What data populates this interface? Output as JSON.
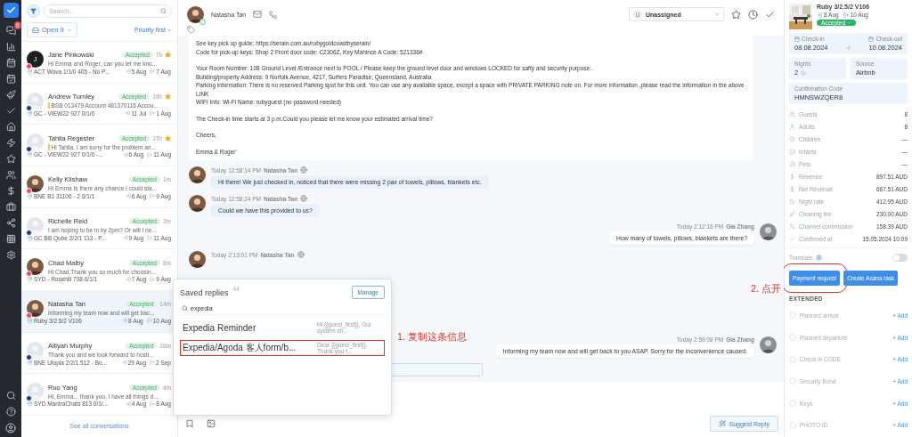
{
  "nav_badge": "8",
  "list": {
    "search_placeholder": "Search...",
    "filter_label": "Open",
    "filter_count": "9",
    "sort": "Priority first",
    "see_all": "See all conversations"
  },
  "conversations": [
    {
      "name": "Jane Pinkowski",
      "status": "Accepted",
      "time": "7h",
      "starred": true,
      "note": false,
      "preview": "Hi Emma and Roger, can you let me kno...",
      "location": "ACT Wova 1/1/0 405 - No P...",
      "check_in": "5 Aug",
      "check_out": "7 Aug",
      "kind": "initial",
      "initial": "J",
      "color": "#e5505b",
      "selected": false
    },
    {
      "name": "Andrew Turnley",
      "status": "Accepted",
      "time": "19h",
      "starred": true,
      "note": true,
      "preview": "BSB 013479 Account 481370116 Accou...",
      "location": "GC - VIEW22 927 0/1/0",
      "check_in": "11 Jul",
      "check_out": "1 Aug",
      "kind": "placeholder",
      "color": "#233a82",
      "selected": false
    },
    {
      "name": "Tahlia Regester",
      "status": "Accepted",
      "time": "17h",
      "starred": true,
      "note": true,
      "preview": "Hi Tahlia, I am sorry for the problem an...",
      "location": "GC - VIEW22 927 0/1/0 -...",
      "check_in": "6 Aug",
      "check_out": "11 Aug",
      "kind": "placeholder",
      "color": "#233a82",
      "selected": false
    },
    {
      "name": "Kelly Kilshaw",
      "status": "Accepted",
      "time": "1m",
      "starred": false,
      "note": false,
      "preview": "Hi Emma Is there any chance I could sta...",
      "location": "BNE B1 31106 - 2 0/1/1",
      "check_in": "6 Aug",
      "check_out": "9 Aug",
      "color": "#e5505b",
      "selected": false
    },
    {
      "name": "Richelle Reid",
      "status": "Accepted",
      "time": "3m",
      "starred": false,
      "note": false,
      "preview": "I am hoping to be in by 2pm? Or will I ne...",
      "location": "GC BB Qube 2/2/1 113 - P...",
      "check_in": "9 Aug",
      "check_out": "11 Aug",
      "kind": "placeholder",
      "color": "#233a82",
      "selected": false
    },
    {
      "name": "Chad Malby",
      "status": "Accepted",
      "time": "8m",
      "starred": false,
      "note": false,
      "preview": "Hi Chad,Thank you so much for choosin...",
      "location": "SYD - Rosehill 708 0/1/1",
      "check_in": "7 Aug",
      "check_out": "9 Aug",
      "color": "#e5505b",
      "selected": false
    },
    {
      "name": "Natasha Tan",
      "status": "Accepted",
      "time": "14m",
      "starred": false,
      "note": false,
      "preview": "Informing my team now and will get bac...",
      "location": "Ruby 3/2.5/2 V106",
      "check_in": "8 Aug",
      "check_out": "10 Aug",
      "color": "#e5505b",
      "selected": true
    },
    {
      "name": "Alliyah Murphy",
      "status": "Accepted",
      "time": "16m",
      "starred": false,
      "note": false,
      "preview": "Thank you and we look forward to hosti...",
      "location": "BNE Utopia 2/2/1 512 - Bo...",
      "check_in": "29 Aug",
      "check_out": "2 Sep",
      "kind": "placeholder",
      "color": "#233a82",
      "selected": false
    },
    {
      "name": "Ruo Yang",
      "status": "Accepted",
      "time": "4m",
      "starred": false,
      "note": false,
      "preview": "Hi, Emma... thank you, I have all things d...",
      "location": "SYD MantraChats 813 0/1/...",
      "check_in": "4 Aug",
      "check_out": "8 Aug",
      "kind": "placeholder",
      "color": "#233a82",
      "selected": false
    }
  ],
  "header": {
    "contact": "Natasha Tan",
    "assignee_initial": "U",
    "assignee": "Unassigned"
  },
  "card_paragraphs": [
    [
      "See key pick up guide: https://serain.com.au/rubygoldcoastbyserain/",
      "Code for pick-up keys: Shop 2 Front door code: C2306Z, Key Mahince A Code: 521336#"
    ],
    [
      "Your Room Number: 108 Ground Level /Entrance next to POOL / Please keep the ground level door and windows LOCKED for safty and security purpose..",
      "Building/property Address: 9 Norfolk Avenue, 4217, Surfers Paradise, Queensland, Australia",
      "Parking information: There is no reserved Parking spot for this unit. You can use any available space, except a space with PRIVATE PARKING note on. For more information ,please read the information in the above LINK",
      "WIFI Info: Wi-Fi Name: rubyguest (no password needed)"
    ],
    [
      "The Check-in time starts at 3 p.m.Could you please let me know your estimated arrival time?"
    ],
    [
      "Cheers,"
    ],
    [
      "Emma & Roger'"
    ]
  ],
  "messages": [
    {
      "kind": "in",
      "time": "Today 12:58:14 PM",
      "author": "Natasha Tan",
      "text": "Hi there! We just checked in, noticed that there were missing 2 pax of towels, pillows, blankets etc."
    },
    {
      "kind": "in",
      "time": "Today 12:58:24 PM",
      "author": "Natasha Tan",
      "text": "Could we have this provided to us?"
    },
    {
      "kind": "out",
      "time": "Today 2:12:16 PM",
      "author": "Gia Zhang",
      "text": "How many of towels, pillows, blankets are there?"
    },
    {
      "kind": "in",
      "time": "Today 2:13:01 PM",
      "author": "Natasha Tan"
    },
    {
      "kind": "out",
      "time": "Today 2:59:08 PM",
      "author": "Gia Zhang",
      "text": "Informing my team now and will get back to you ASAP. Sorry for the inconvenience caused."
    }
  ],
  "saved_replies": {
    "title": "Saved replies",
    "count": "44",
    "manage": "Manage",
    "search": "expedia",
    "items": [
      {
        "title": "Expedia Reminder",
        "snippet": "Hi {{guest_first}}, Our system sh...",
        "boxed": false
      },
      {
        "title": "Expedia/Agoda 客人form/b...",
        "snippet": "Dear {{guest_first}}, Thank you f...",
        "boxed": true
      }
    ]
  },
  "composer": {
    "suggest": "Suggest Reply"
  },
  "annotations": [
    {
      "text": "1. 复制这条信息",
      "kind": "step1"
    },
    {
      "text": "2. 点开",
      "kind": "step2"
    }
  ],
  "booking": {
    "property": "Ruby 3/2.5/2 V106",
    "check_in": "8 Aug",
    "check_out": "10 Aug",
    "status": "Accepted"
  },
  "dates": {
    "check_in_label": "Check-in",
    "check_in": "08.08.2024",
    "check_out_label": "Check-out",
    "check_out": "10.08.2024"
  },
  "tiles": [
    {
      "label": "Nights",
      "value": "2"
    },
    {
      "label": "Source",
      "value": "Airbnb"
    }
  ],
  "confirmation": {
    "label": "Confirmation Code",
    "value": "HMNSWZQER8"
  },
  "details": [
    {
      "label": "Guests",
      "value": "8"
    },
    {
      "label": "Adults",
      "value": "8"
    },
    {
      "label": "Children",
      "value": "—"
    },
    {
      "label": "Infants",
      "value": "—"
    },
    {
      "label": "Pets",
      "value": "—"
    },
    {
      "label": "Revenue",
      "value": "897.51 AUD"
    },
    {
      "label": "Net Revenue",
      "value": "667.51 AUD"
    },
    {
      "label": "Night rate",
      "value": "412.95 AUD"
    },
    {
      "label": "Cleaning fee",
      "value": "230.00 AUD"
    },
    {
      "label": "Channel commission",
      "value": "158.39 AUD"
    },
    {
      "label": "Confirmed at",
      "value": "15.05.2024 10:09"
    }
  ],
  "translate": {
    "label": "Translate",
    "on": false
  },
  "actions": [
    {
      "label": "Payment request",
      "boxed": true
    },
    {
      "label": "Create Asana task",
      "boxed": false
    }
  ],
  "extended": {
    "title": "EXTENDED",
    "items": [
      {
        "label": "Planned arrival",
        "action": "+ Add"
      },
      {
        "label": "Planned departure",
        "action": "+ Add"
      },
      {
        "label": "Check in CODE",
        "action": "+ Add"
      },
      {
        "label": "Security Bond",
        "action": "+ Add"
      },
      {
        "label": "Keys",
        "action": "+ Add"
      },
      {
        "label": "PHOTO ID",
        "action": "+ Add"
      }
    ]
  }
}
